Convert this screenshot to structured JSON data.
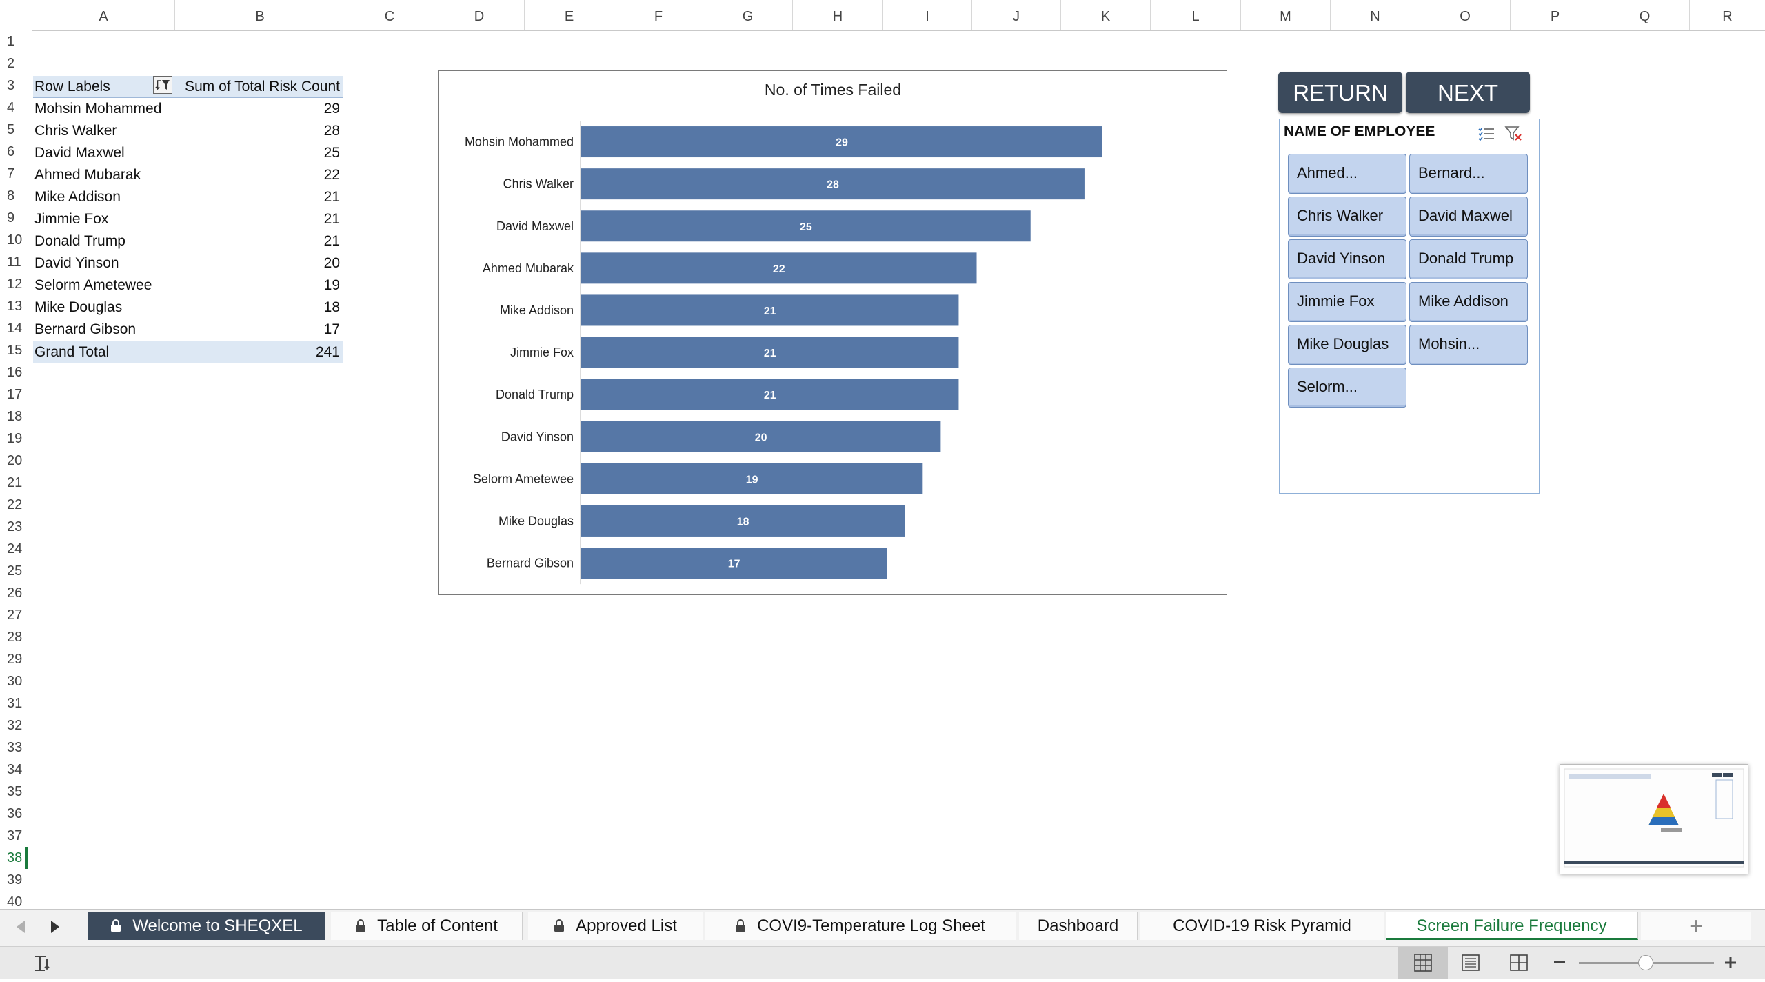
{
  "columns": [
    "A",
    "B",
    "C",
    "D",
    "E",
    "F",
    "G",
    "H",
    "I",
    "J",
    "K",
    "L",
    "M",
    "N",
    "O",
    "P",
    "Q",
    "R"
  ],
  "rows": [
    "1",
    "2",
    "3",
    "4",
    "5",
    "6",
    "7",
    "8",
    "9",
    "10",
    "11",
    "12",
    "13",
    "14",
    "15",
    "16",
    "17",
    "18",
    "19",
    "20",
    "21",
    "22",
    "23",
    "24",
    "25",
    "26",
    "27",
    "28",
    "29",
    "30",
    "31",
    "32",
    "33",
    "34",
    "35",
    "36",
    "37",
    "38",
    "39",
    "40"
  ],
  "active_row": "38",
  "pivot": {
    "header_label": "Row Labels",
    "header_value": "Sum of Total Risk Count",
    "rows": [
      {
        "label": "Mohsin Mohammed",
        "value": "29"
      },
      {
        "label": "Chris Walker",
        "value": "28"
      },
      {
        "label": "David Maxwel",
        "value": "25"
      },
      {
        "label": "Ahmed Mubarak",
        "value": "22"
      },
      {
        "label": "Mike Addison",
        "value": "21"
      },
      {
        "label": "Jimmie Fox",
        "value": "21"
      },
      {
        "label": "Donald Trump",
        "value": "21"
      },
      {
        "label": "David Yinson",
        "value": "20"
      },
      {
        "label": "Selorm Ametewee",
        "value": "19"
      },
      {
        "label": "Mike Douglas",
        "value": "18"
      },
      {
        "label": "Bernard Gibson",
        "value": "17"
      }
    ],
    "total_label": "Grand Total",
    "total_value": "241"
  },
  "chart_data": {
    "type": "bar",
    "orientation": "horizontal",
    "title": "No. of Times Failed",
    "categories": [
      "Mohsin Mohammed",
      "Chris Walker",
      "David Maxwel",
      "Ahmed Mubarak",
      "Mike Addison",
      "Jimmie Fox",
      "Donald Trump",
      "David Yinson",
      "Selorm Ametewee",
      "Mike Douglas",
      "Bernard Gibson"
    ],
    "values": [
      29,
      28,
      25,
      22,
      21,
      21,
      21,
      20,
      19,
      18,
      17
    ],
    "bar_color": "#5677a6",
    "data_labels": true,
    "grid": false,
    "legend": "none"
  },
  "buttons": {
    "return": "RETURN",
    "next": "NEXT"
  },
  "slicer": {
    "title": "NAME OF EMPLOYEE",
    "items": [
      "Ahmed...",
      "Bernard...",
      "Chris Walker",
      "David Maxwel",
      "David Yinson",
      "Donald Trump",
      "Jimmie Fox",
      "Mike Addison",
      "Mike Douglas",
      "Mohsin...",
      "Selorm..."
    ]
  },
  "tabs": [
    {
      "label": "Welcome to SHEQXEL",
      "locked": true,
      "style": "dark"
    },
    {
      "label": "Table of Content",
      "locked": true,
      "style": "normal"
    },
    {
      "label": "Approved List",
      "locked": true,
      "style": "normal"
    },
    {
      "label": "COVI9-Temperature Log Sheet",
      "locked": true,
      "style": "normal"
    },
    {
      "label": "Dashboard",
      "locked": false,
      "style": "normal"
    },
    {
      "label": "COVID-19 Risk Pyramid",
      "locked": false,
      "style": "normal"
    },
    {
      "label": "Screen Failure Frequency",
      "locked": false,
      "style": "active"
    }
  ],
  "add_sheet_symbol": "+",
  "icons": {
    "nav_prev": "triangle-left-icon",
    "nav_next": "triangle-right-icon",
    "lock": "lock-icon",
    "slicer_multiselect": "multi-select-icon",
    "slicer_clear": "clear-filter-icon",
    "view_normal": "normal-view-icon",
    "view_page_layout": "page-layout-icon",
    "view_page_break": "page-break-icon",
    "zoom_out": "minus-icon",
    "zoom_in": "plus-icon"
  }
}
